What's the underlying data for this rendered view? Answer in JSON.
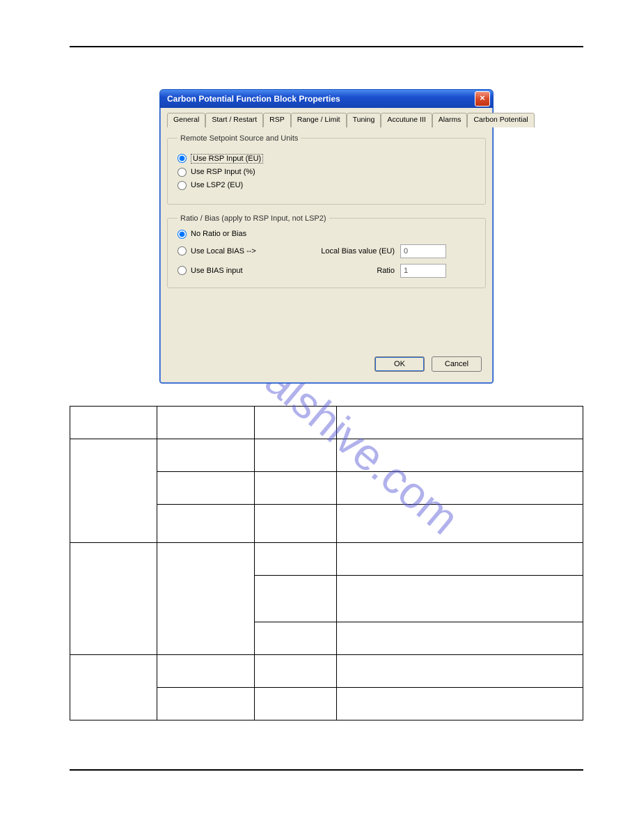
{
  "dialog": {
    "title": "Carbon Potential Function Block Properties",
    "tabs": [
      "General",
      "Start / Restart",
      "RSP",
      "Range / Limit",
      "Tuning",
      "Accutune III",
      "Alarms",
      "Carbon Potential"
    ],
    "active_tab": 2,
    "group1": {
      "legend": "Remote Setpoint Source and Units",
      "options": [
        "Use RSP Input (EU)",
        "Use RSP Input (%)",
        "Use LSP2 (EU)"
      ],
      "selected": 0
    },
    "group2": {
      "legend": "Ratio / Bias (apply to RSP Input, not LSP2)",
      "options": [
        "No Ratio or Bias",
        "Use Local BIAS -->",
        "Use BIAS input"
      ],
      "selected": 0,
      "bias_label": "Local Bias value (EU)",
      "bias_value": "0",
      "ratio_label": "Ratio",
      "ratio_value": "1"
    },
    "buttons": {
      "ok": "OK",
      "cancel": "Cancel"
    }
  },
  "watermark": "manualshive.com"
}
